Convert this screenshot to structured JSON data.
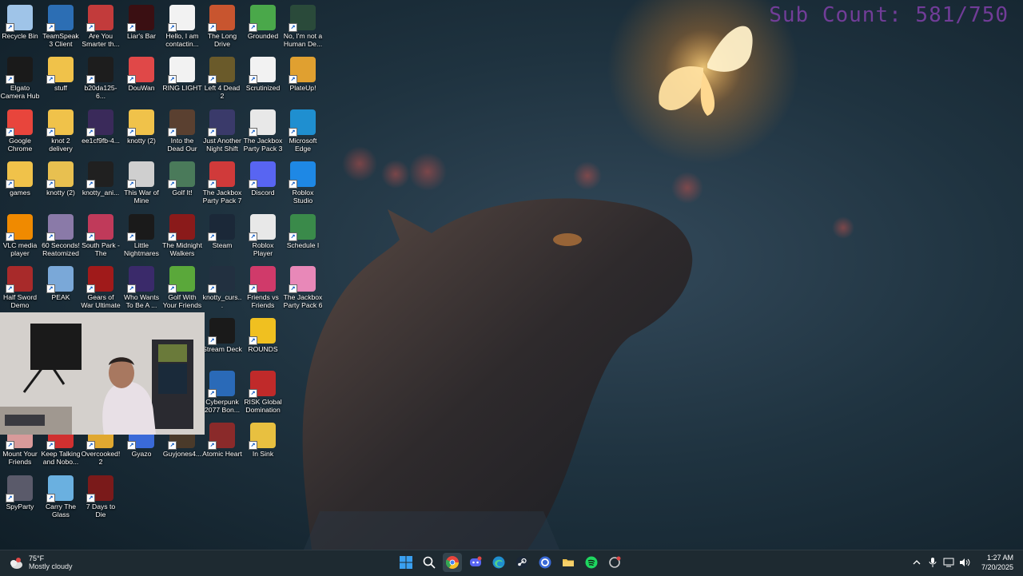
{
  "overlay": {
    "sub_count": "Sub Count: 581/750"
  },
  "desktop_icons": [
    {
      "label": "Recycle Bin",
      "icon": "recycle-bin-icon",
      "color": "#9fc4e8"
    },
    {
      "label": "TeamSpeak 3 Client",
      "icon": "teamspeak-icon",
      "color": "#2c6eb4"
    },
    {
      "label": "Are You Smarter th...",
      "icon": "game-icon",
      "color": "#c23b3b"
    },
    {
      "label": "Liar's Bar",
      "icon": "game-icon",
      "color": "#3a0f12"
    },
    {
      "label": "Hello, I am contactin...",
      "icon": "document-icon",
      "color": "#f2f2f2"
    },
    {
      "label": "The Long Drive",
      "icon": "game-icon",
      "color": "#c8552f"
    },
    {
      "label": "Grounded",
      "icon": "game-icon",
      "color": "#4aa84a"
    },
    {
      "label": "No, I'm not a Human De...",
      "icon": "game-icon",
      "color": "#2a4a3a"
    },
    {
      "label": "Elgato Camera Hub",
      "icon": "camera-icon",
      "color": "#1a1a1a"
    },
    {
      "label": "stuff",
      "icon": "folder-icon",
      "color": "#f0c24a"
    },
    {
      "label": "b20da125-6...",
      "icon": "image-icon",
      "color": "#1d1d1d"
    },
    {
      "label": "DouWan",
      "icon": "app-icon",
      "color": "#e04848"
    },
    {
      "label": "RING LIGHT",
      "icon": "document-icon",
      "color": "#f2f2f2"
    },
    {
      "label": "Left 4 Dead 2",
      "icon": "game-icon",
      "color": "#6a5a2a"
    },
    {
      "label": "Scrutinized",
      "icon": "document-icon",
      "color": "#f2f2f2"
    },
    {
      "label": "PlateUp!",
      "icon": "game-icon",
      "color": "#e0a030"
    },
    {
      "label": "Google Chrome",
      "icon": "chrome-icon",
      "color": "#e8453c"
    },
    {
      "label": "knot 2 delivery",
      "icon": "folder-icon",
      "color": "#f0c24a"
    },
    {
      "label": "ee1cf9fb-4...",
      "icon": "image-icon",
      "color": "#3a2a5a"
    },
    {
      "label": "knotty (2)",
      "icon": "folder-icon",
      "color": "#f0c24a"
    },
    {
      "label": "Into the Dead Our Darkest...",
      "icon": "game-icon",
      "color": "#5a4030"
    },
    {
      "label": "Just Another Night Shift",
      "icon": "game-icon",
      "color": "#3a3a6a"
    },
    {
      "label": "The Jackbox Party Pack 3",
      "icon": "game-icon",
      "color": "#e8e8e8"
    },
    {
      "label": "Microsoft Edge",
      "icon": "edge-icon",
      "color": "#1f8fd0"
    },
    {
      "label": "games",
      "icon": "folder-icon",
      "color": "#f0c24a"
    },
    {
      "label": "knotty (2)",
      "icon": "folder-icon",
      "color": "#e8c050"
    },
    {
      "label": "knotty_ani...",
      "icon": "video-icon",
      "color": "#202020"
    },
    {
      "label": "This War of Mine",
      "icon": "game-icon",
      "color": "#cfcfcf"
    },
    {
      "label": "Golf It!",
      "icon": "game-icon",
      "color": "#4a7a5a"
    },
    {
      "label": "The Jackbox Party Pack 7",
      "icon": "game-icon",
      "color": "#d03a3a"
    },
    {
      "label": "Discord",
      "icon": "discord-icon",
      "color": "#5865f2"
    },
    {
      "label": "Roblox Studio",
      "icon": "roblox-studio-icon",
      "color": "#1e88e5"
    },
    {
      "label": "VLC media player",
      "icon": "vlc-icon",
      "color": "#f08a00"
    },
    {
      "label": "60 Seconds! Reatomized",
      "icon": "game-icon",
      "color": "#8a7aa8"
    },
    {
      "label": "South Park - The Fractur...",
      "icon": "game-icon",
      "color": "#c03a5a"
    },
    {
      "label": "Little Nightmares",
      "icon": "game-icon",
      "color": "#1a1a1a"
    },
    {
      "label": "The Midnight Walkers Pla...",
      "icon": "game-icon",
      "color": "#8a1a1a"
    },
    {
      "label": "Steam",
      "icon": "steam-icon",
      "color": "#1b2838"
    },
    {
      "label": "Roblox Player",
      "icon": "roblox-icon",
      "color": "#e8e8e8"
    },
    {
      "label": "Schedule I",
      "icon": "game-icon",
      "color": "#3a8a4a"
    },
    {
      "label": "Half Sword Demo",
      "icon": "game-icon",
      "color": "#a82a2a"
    },
    {
      "label": "PEAK",
      "icon": "game-icon",
      "color": "#7aa8d8"
    },
    {
      "label": "Gears of War Ultimate E...",
      "icon": "game-icon",
      "color": "#a01a1a"
    },
    {
      "label": "Who Wants To Be A ...",
      "icon": "game-icon",
      "color": "#3a2a6a"
    },
    {
      "label": "Golf With Your Friends",
      "icon": "game-icon",
      "color": "#5aa83a"
    },
    {
      "label": "knotty_curs...",
      "icon": "cursor-icon",
      "color": "#223040"
    },
    {
      "label": "Friends vs Friends",
      "icon": "game-icon",
      "color": "#d03a6a"
    },
    {
      "label": "The Jackbox Party Pack 6",
      "icon": "game-icon",
      "color": "#e888b8"
    },
    {
      "label": "Stream Deck",
      "icon": "stream-deck-icon",
      "color": "#1a1a1a"
    },
    {
      "label": "ROUNDS",
      "icon": "game-icon",
      "color": "#f0c020"
    },
    {
      "label": "Cyberpunk 2077 Bon...",
      "icon": "game-icon",
      "color": "#2a6ab8"
    },
    {
      "label": "RISK Global Domination",
      "icon": "game-icon",
      "color": "#c02a2a"
    },
    {
      "label": "Mount Your Friends",
      "icon": "game-icon",
      "color": "#d89a9a"
    },
    {
      "label": "Keep Talking and Nobo...",
      "icon": "game-icon",
      "color": "#d03030"
    },
    {
      "label": "Overcooked! 2",
      "icon": "game-icon",
      "color": "#e0a830"
    },
    {
      "label": "Gyazo",
      "icon": "gyazo-icon",
      "color": "#3a6ad8"
    },
    {
      "label": "Guyjones4...",
      "icon": "image-icon",
      "color": "#4a3a2a"
    },
    {
      "label": "Atomic Heart",
      "icon": "game-icon",
      "color": "#8a2a2a"
    },
    {
      "label": "In Sink",
      "icon": "game-icon",
      "color": "#e8c040"
    },
    {
      "label": "SpyParty",
      "icon": "game-icon",
      "color": "#5a5a6a"
    },
    {
      "label": "Carry The Glass",
      "icon": "game-icon",
      "color": "#6ab0e0"
    },
    {
      "label": "7 Days to Die",
      "icon": "game-icon",
      "color": "#7a1a1a"
    }
  ],
  "taskbar": {
    "weather": {
      "temp": "75°F",
      "condition": "Mostly cloudy",
      "icon": "weather-cloud-icon"
    },
    "pinned": [
      {
        "name": "start",
        "icon": "windows-start-icon"
      },
      {
        "name": "search",
        "icon": "search-icon"
      },
      {
        "name": "chrome",
        "icon": "chrome-icon",
        "active": true
      },
      {
        "name": "discord",
        "icon": "discord-icon"
      },
      {
        "name": "edge",
        "icon": "edge-icon"
      },
      {
        "name": "steam",
        "icon": "steam-icon"
      },
      {
        "name": "gyazo",
        "icon": "gyazo-icon"
      },
      {
        "name": "file-explorer",
        "icon": "folder-icon"
      },
      {
        "name": "spotify",
        "icon": "spotify-icon"
      },
      {
        "name": "app",
        "icon": "app-icon"
      }
    ],
    "tray": {
      "time": "1:27 AM",
      "date": "7/20/2025"
    }
  }
}
